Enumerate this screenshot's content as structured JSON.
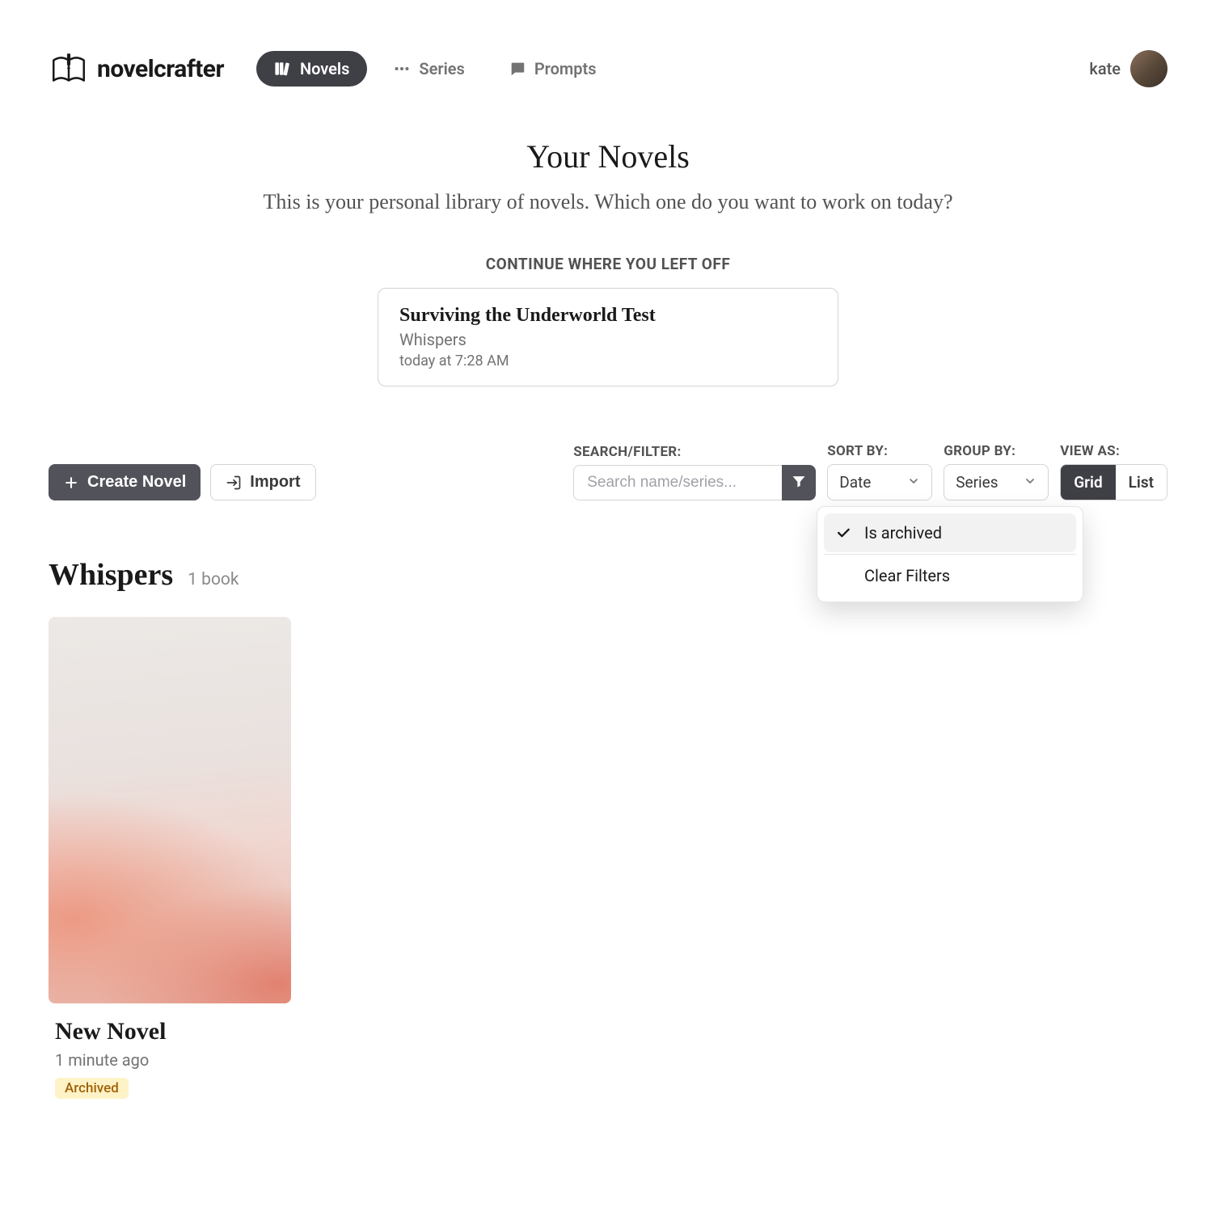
{
  "brand": "novelcrafter",
  "nav": {
    "novels": "Novels",
    "series": "Series",
    "prompts": "Prompts"
  },
  "user": {
    "name": "kate"
  },
  "page": {
    "title": "Your Novels",
    "subtitle": "This is your personal library of novels. Which one do you want to work on today?"
  },
  "continue": {
    "label": "CONTINUE WHERE YOU LEFT OFF",
    "title": "Surviving the Underworld Test",
    "series": "Whispers",
    "time": "today at 7:28 AM"
  },
  "toolbar": {
    "create": "Create Novel",
    "import": "Import",
    "search_label": "SEARCH/FILTER:",
    "search_placeholder": "Search name/series...",
    "sort_label": "SORT BY:",
    "sort_value": "Date",
    "group_label": "GROUP BY:",
    "group_value": "Series",
    "view_label": "VIEW AS:",
    "view_grid": "Grid",
    "view_list": "List"
  },
  "filter_menu": {
    "is_archived": "Is archived",
    "clear": "Clear Filters"
  },
  "group": {
    "name": "Whispers",
    "count": "1 book"
  },
  "novel": {
    "title": "New Novel",
    "time": "1 minute ago",
    "badge": "Archived"
  }
}
